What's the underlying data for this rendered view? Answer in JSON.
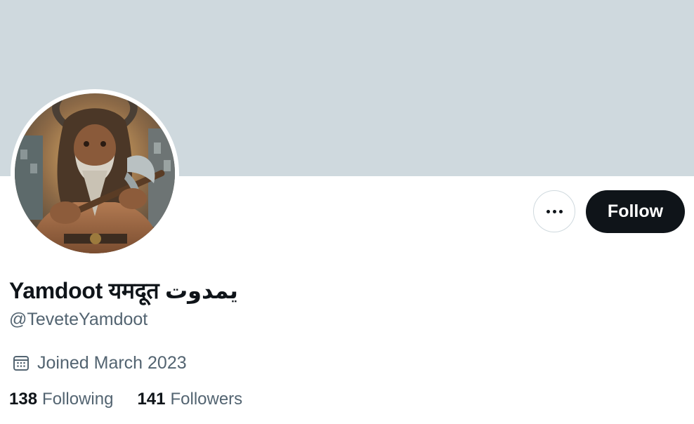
{
  "profile": {
    "display_name": "Yamdoot यमदूत يمدوت",
    "handle": "@TeveteYamdoot",
    "joined": "Joined March 2023",
    "following_count": "138",
    "following_label": "Following",
    "followers_count": "141",
    "followers_label": "Followers"
  },
  "actions": {
    "follow_label": "Follow",
    "more_icon": "more-horizontal-icon"
  },
  "icons": {
    "calendar": "calendar-icon"
  },
  "colors": {
    "banner": "#cfd9de",
    "primary_text": "#0f1419",
    "secondary_text": "#536471",
    "follow_bg": "#0f1419",
    "follow_text": "#ffffff"
  }
}
